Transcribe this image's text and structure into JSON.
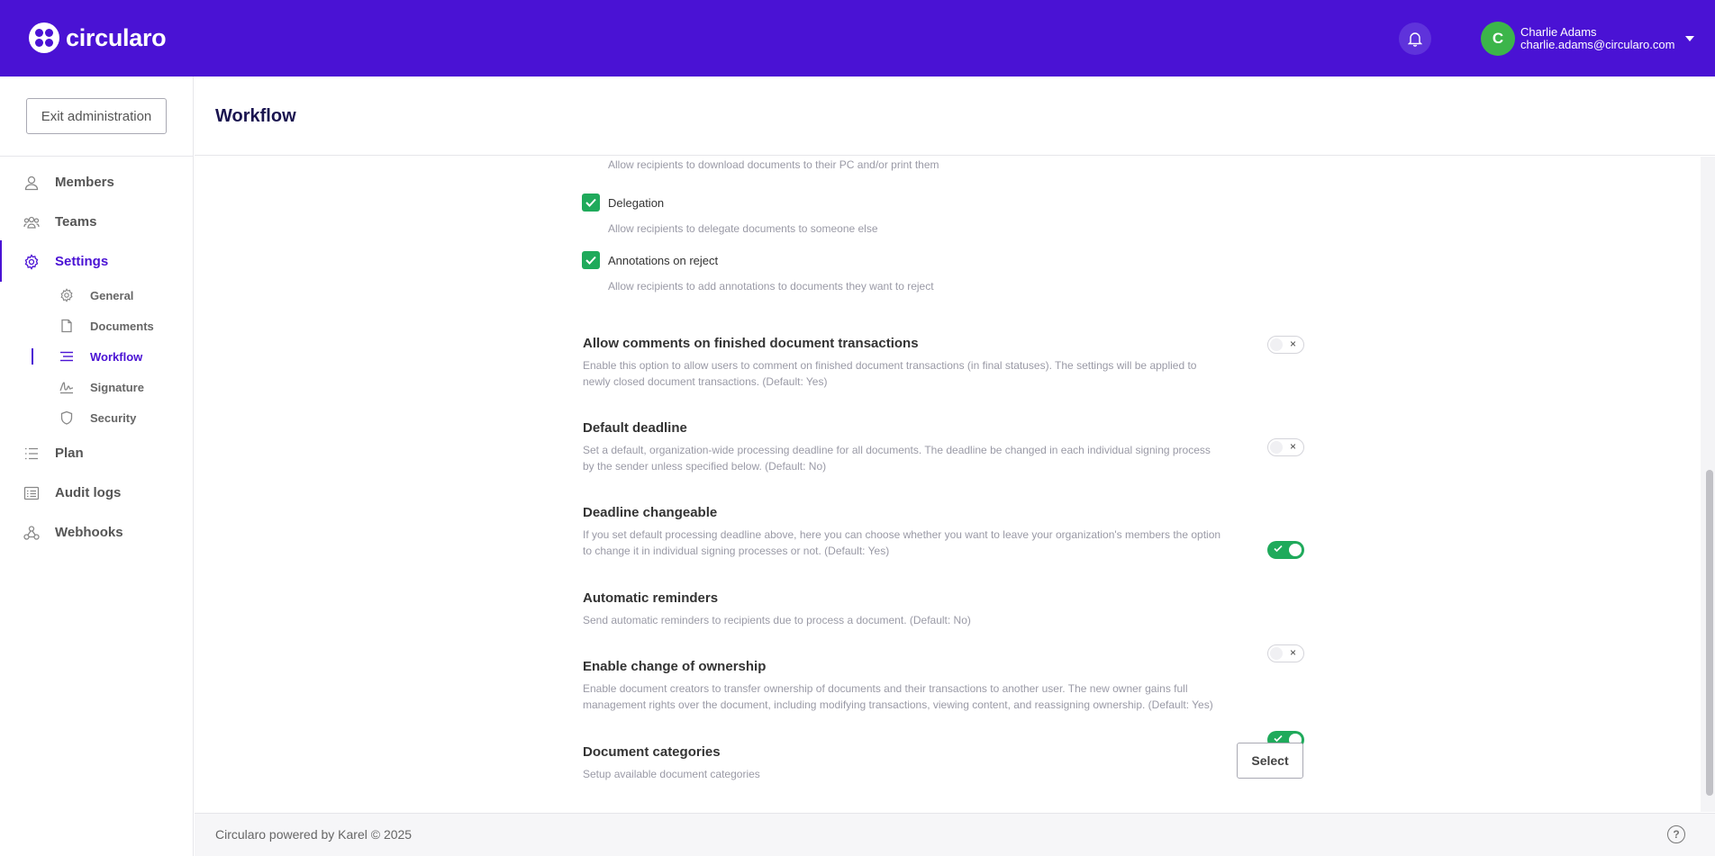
{
  "brand": {
    "name": "circularo",
    "primary_color": "#4a12d4"
  },
  "header": {
    "notifications_icon": "bell-icon",
    "user": {
      "initial": "C",
      "name": "Charlie Adams",
      "email": "charlie.adams@circularo.com",
      "avatar_color": "#3cb54a"
    }
  },
  "sidebar": {
    "exit_label": "Exit administration",
    "items": [
      {
        "label": "Members",
        "icon": "user-icon"
      },
      {
        "label": "Teams",
        "icon": "team-icon"
      },
      {
        "label": "Settings",
        "icon": "gear-icon",
        "active": true
      },
      {
        "label": "Plan",
        "icon": "list-icon"
      },
      {
        "label": "Audit logs",
        "icon": "log-icon"
      },
      {
        "label": "Webhooks",
        "icon": "webhook-icon"
      }
    ],
    "settings_sub": [
      {
        "label": "General",
        "icon": "gear-icon"
      },
      {
        "label": "Documents",
        "icon": "document-icon"
      },
      {
        "label": "Workflow",
        "icon": "workflow-icon",
        "active": true
      },
      {
        "label": "Signature",
        "icon": "signature-icon"
      },
      {
        "label": "Security",
        "icon": "shield-icon"
      }
    ]
  },
  "page": {
    "title": "Workflow"
  },
  "recipient_options": {
    "download_desc": "Allow recipients to download documents to their PC and/or print them",
    "items": [
      {
        "label": "Delegation",
        "checked": true,
        "desc": "Allow recipients to delegate documents to someone else"
      },
      {
        "label": "Annotations on reject",
        "checked": true,
        "desc": "Allow recipients to add annotations to documents they want to reject"
      }
    ]
  },
  "settings": [
    {
      "title": "Allow comments on finished document transactions",
      "desc_line1": "Enable this option to allow users to comment on finished document transactions (in final statuses). The settings will be applied to",
      "desc_line2": "newly closed document transactions.  (Default: Yes)",
      "enabled": false
    },
    {
      "title": "Default deadline",
      "desc_line1": "Set a default, organization-wide processing deadline for all documents. The deadline be changed in each individual signing process",
      "desc_line2": "by the sender unless specified below.  (Default: No)",
      "enabled": false
    },
    {
      "title": "Deadline changeable",
      "desc_line1": "If you set default processing deadline above, here you can choose whether you want to leave your organization's members the option",
      "desc_line2": "to change it in individual signing processes or not.  (Default: Yes)",
      "enabled": true
    },
    {
      "title": "Automatic reminders",
      "desc_line1": "Send automatic reminders to recipients due to process a document.  (Default: No)",
      "desc_line2": "",
      "enabled": false
    },
    {
      "title": "Enable change of ownership",
      "desc_line1": "Enable document creators to transfer ownership of documents and their transactions to another user. The new owner gains full",
      "desc_line2": "management rights over the document, including modifying transactions, viewing content, and reassigning ownership.  (Default: Yes)",
      "enabled": true
    }
  ],
  "categories": {
    "title": "Document categories",
    "desc": "Setup available document categories",
    "button_label": "Select"
  },
  "toggle_off_glyph": "×",
  "help_glyph": "?",
  "footer": {
    "text": "Circularo powered by Karel © 2025"
  }
}
